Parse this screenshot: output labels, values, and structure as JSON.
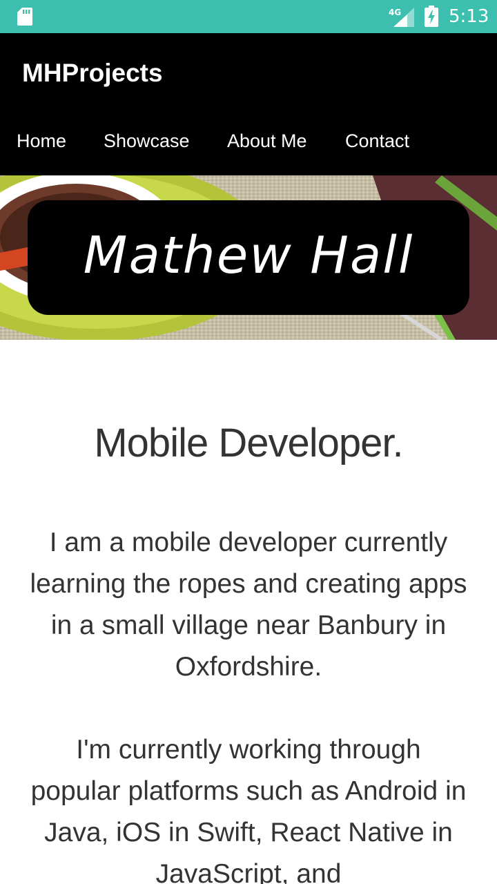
{
  "status_bar": {
    "network": "4G",
    "time": "5:13",
    "icons": [
      "sd-card-icon",
      "signal-icon",
      "battery-charging-icon"
    ],
    "bg_color": "#3cbfae"
  },
  "header": {
    "brand": "MHProjects",
    "nav": {
      "home": "Home",
      "showcase": "Showcase",
      "about": "About Me",
      "contact": "Contact"
    },
    "bg_color": "#000000"
  },
  "hero": {
    "name": "Mathew Hall"
  },
  "content": {
    "headline": "Mobile Developer.",
    "paragraph_1": "I am a mobile developer currently learning the ropes and creating apps in a small village near Banbury in Oxfordshire.",
    "paragraph_2": "I'm currently working through popular platforms such as Android in Java, iOS in Swift, React Native in JavaScript, and"
  }
}
